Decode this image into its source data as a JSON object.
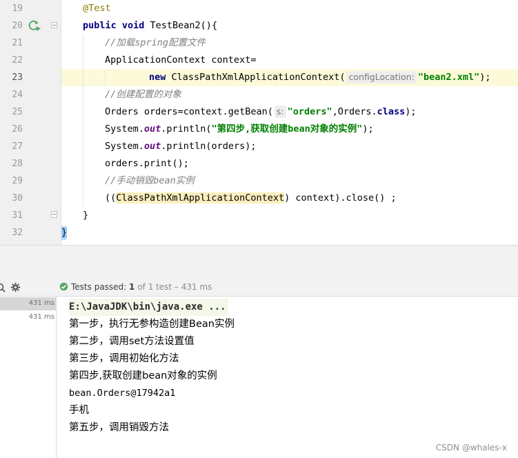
{
  "editor": {
    "line_numbers": [
      "19",
      "20",
      "21",
      "22",
      "23",
      "24",
      "25",
      "26",
      "27",
      "28",
      "29",
      "30",
      "31",
      "32"
    ],
    "lines": [
      [
        {
          "t": "@Test",
          "c": "ann"
        }
      ],
      [
        {
          "t": "public void",
          "c": "kw"
        },
        {
          "t": " TestBean2(){"
        }
      ],
      [
        {
          "t": "//加载spring配置文件",
          "c": "cm"
        }
      ],
      [
        {
          "t": "ApplicationContext context="
        }
      ],
      [
        {
          "t": "new",
          "c": "kw"
        },
        {
          "t": " ClassPathXmlApplicationContext("
        },
        {
          "t": "configLocation:",
          "c": "hint"
        },
        {
          "t": "\"bean2.xml\"",
          "c": "st"
        },
        {
          "t": ");"
        }
      ],
      [
        {
          "t": "//创建配置的对象",
          "c": "cm"
        }
      ],
      [
        {
          "t": "Orders orders=context.getBean("
        },
        {
          "t": "s:",
          "c": "hint"
        },
        {
          "t": "\"orders\"",
          "c": "st"
        },
        {
          "t": ",Orders."
        },
        {
          "t": "class",
          "c": "kw"
        },
        {
          "t": ");"
        }
      ],
      [
        {
          "t": "System."
        },
        {
          "t": "out",
          "c": "fld"
        },
        {
          "t": ".println("
        },
        {
          "t": "\"第四步,获取创建bean对象的实例\"",
          "c": "st"
        },
        {
          "t": ");"
        }
      ],
      [
        {
          "t": "System."
        },
        {
          "t": "out",
          "c": "fld"
        },
        {
          "t": ".println(orders);"
        }
      ],
      [
        {
          "t": "orders.print();"
        }
      ],
      [
        {
          "t": "//手动销毁bean实例",
          "c": "cm"
        }
      ],
      [
        {
          "t": "(("
        },
        {
          "t": "ClassPathXmlApplicationContext",
          "c": "hl"
        },
        {
          "t": ") context).close() ;"
        }
      ],
      [
        {
          "t": "}"
        }
      ],
      [
        {
          "t": "}",
          "c": "brace-hl"
        }
      ]
    ]
  },
  "run": {
    "tests_passed_label": "Tests passed:",
    "tests_passed_count": "1",
    "tests_passed_detail": "of 1 test – 431 ms",
    "tree_times": [
      "431 ms",
      "431 ms"
    ],
    "output": [
      "E:\\JavaJDK\\bin\\java.exe ...",
      "第一步，执行无参构造创建Bean实例",
      "第二步，调用set方法设置值",
      "第三步，调用初始化方法",
      "第四步,获取创建bean对象的实例",
      "bean.Orders@17942a1",
      "手机",
      "第五步，调用销毁方法"
    ]
  },
  "watermark": "CSDN @whales-x",
  "colors": {
    "keyword": "#000080",
    "string": "#008000",
    "comment": "#808080",
    "annotation": "#808000",
    "field": "#660e7a",
    "current_line": "#fcfad9",
    "pass_green": "#59a869"
  },
  "icons": [
    "run-test-icon",
    "fold-icon",
    "search-icon",
    "gear-icon",
    "check-circle-icon"
  ]
}
